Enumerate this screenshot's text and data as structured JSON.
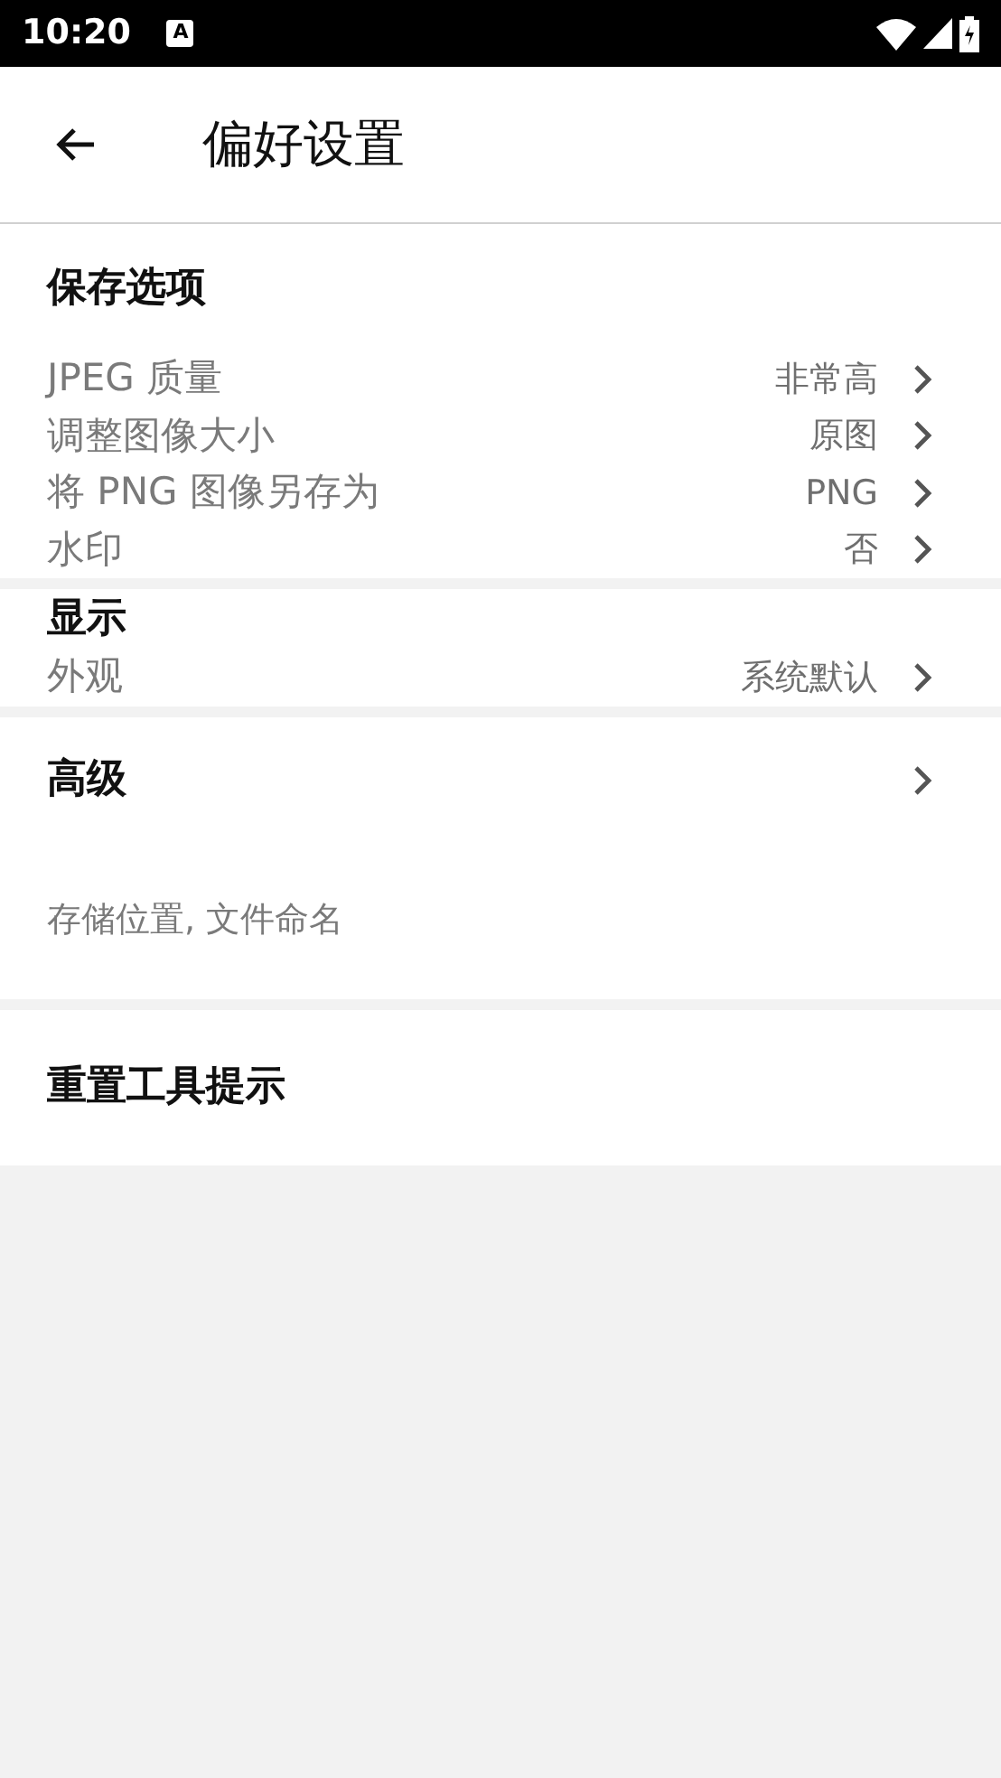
{
  "status_bar": {
    "time": "10:20",
    "notification": "A"
  },
  "app_bar": {
    "title": "偏好设置"
  },
  "sections": [
    {
      "kind": "list",
      "title": "保存选项",
      "items": [
        {
          "label": "JPEG 质量",
          "value": "非常高"
        },
        {
          "label": "调整图像大小",
          "value": "原图"
        },
        {
          "label": "将 PNG 图像另存为",
          "value": "PNG"
        },
        {
          "label": "水印",
          "value": "否"
        }
      ]
    },
    {
      "kind": "list",
      "title": "显示",
      "items": [
        {
          "label": "外观",
          "value": "系统默认"
        }
      ]
    },
    {
      "kind": "link",
      "title": "高级",
      "subtitle": "存储位置, 文件命名"
    },
    {
      "kind": "action",
      "title": "重置工具提示"
    }
  ]
}
